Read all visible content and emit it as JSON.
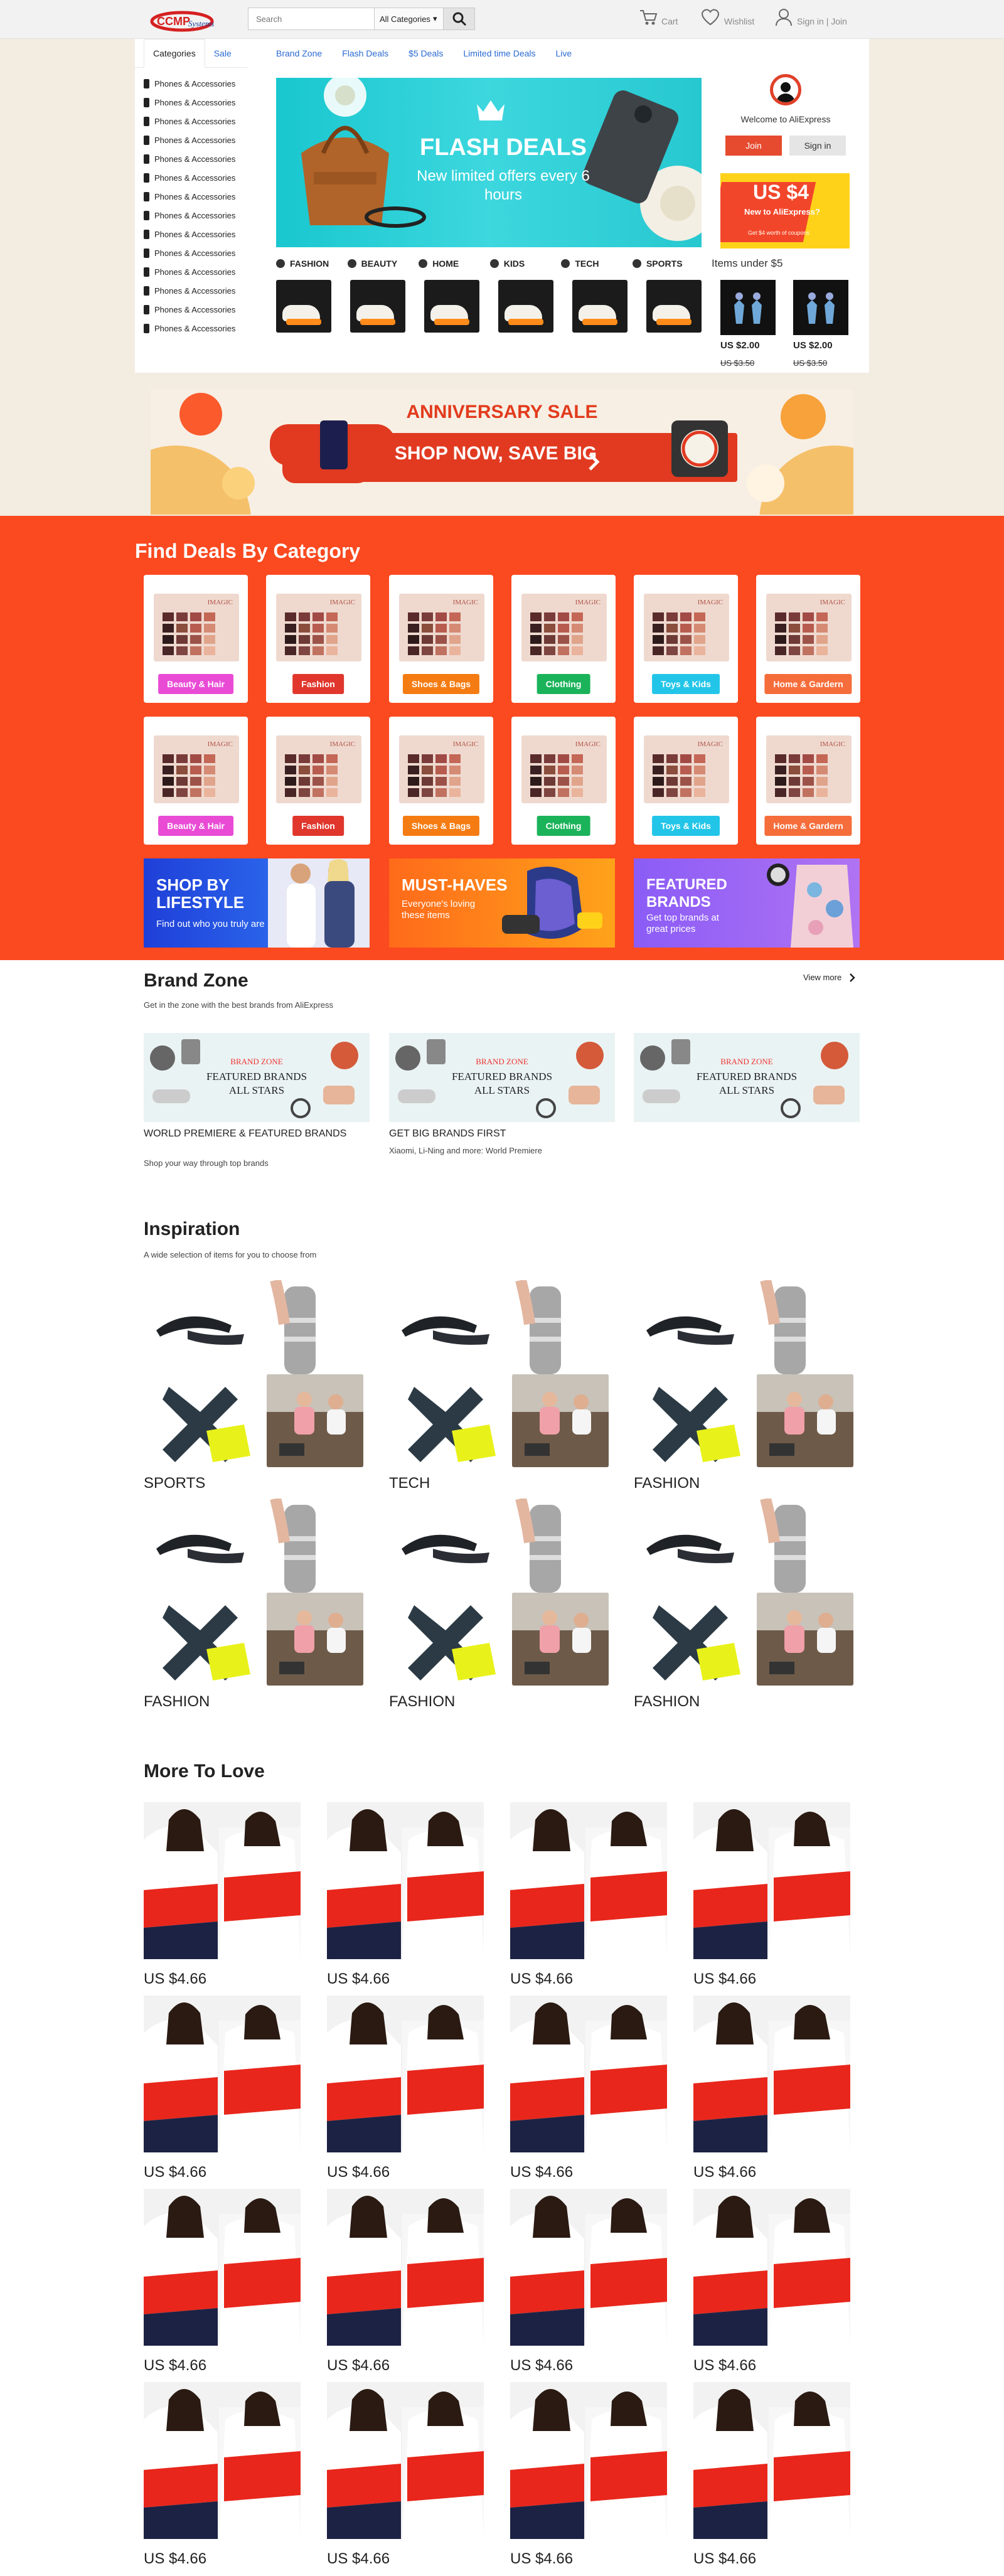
{
  "header": {
    "logo_text": "CCMPSystems",
    "search_placeholder": "Search",
    "category_select": "All Categories",
    "cart": "Cart",
    "wishlist": "Wishlist",
    "account": "Sign in | Join"
  },
  "sidebar": {
    "tabs": [
      "Categories",
      "Sale"
    ],
    "items": [
      "Phones & Accessories",
      "Phones & Accessories",
      "Phones & Accessories",
      "Phones & Accessories",
      "Phones & Accessories",
      "Phones & Accessories",
      "Phones & Accessories",
      "Phones & Accessories",
      "Phones & Accessories",
      "Phones & Accessories",
      "Phones & Accessories",
      "Phones & Accessories",
      "Phones & Accessories",
      "Phones & Accessories"
    ]
  },
  "subnav": [
    "Brand Zone",
    "Flash Deals",
    "$5 Deals",
    "Limited time Deals",
    "Live"
  ],
  "hero": {
    "title": "FLASH DEALS",
    "subtitle": "New limited offers every 6 hours"
  },
  "category_tabs": [
    "FASHION",
    "BEAUTY",
    "HOME",
    "KIDS",
    "TECH",
    "SPORTS"
  ],
  "user_panel": {
    "welcome": "Welcome to AliExpress",
    "join": "Join",
    "sign_in": "Sign in"
  },
  "promo": {
    "price": "US $4",
    "line1": "New to AliExpress?",
    "line2": "Get $4 worth of coupons"
  },
  "items_under": {
    "title": "Items under $5",
    "items": [
      {
        "price": "US $2.00",
        "old_price": "US $3.50"
      },
      {
        "price": "US $2.00",
        "old_price": "US $3.50"
      }
    ]
  },
  "anniversary": {
    "title": "ANNIVERSARY SALE",
    "cta": "SHOP NOW, SAVE BIG"
  },
  "find_deals": {
    "title": "Find Deals By Category",
    "palette_brand": "IMAGIC",
    "row1": [
      {
        "label": "Beauty & Hair",
        "color": "#e94bd5"
      },
      {
        "label": "Fashion",
        "color": "#e0362c"
      },
      {
        "label": "Shoes & Bags",
        "color": "#f57c12"
      },
      {
        "label": "Clothing",
        "color": "#1bb35a"
      },
      {
        "label": "Toys & Kids",
        "color": "#22c5e8"
      },
      {
        "label": "Home & Gardern",
        "color": "#f56d3b"
      }
    ],
    "row2": [
      {
        "label": "Beauty & Hair",
        "color": "#e94bd5"
      },
      {
        "label": "Fashion",
        "color": "#e0362c"
      },
      {
        "label": "Shoes & Bags",
        "color": "#f57c12"
      },
      {
        "label": "Clothing",
        "color": "#1bb35a"
      },
      {
        "label": "Toys & Kids",
        "color": "#22c5e8"
      },
      {
        "label": "Home & Gardern",
        "color": "#f56d3b"
      }
    ],
    "banners": [
      {
        "title": "SHOP BY LIFESTYLE",
        "sub": "Find out who you truly are"
      },
      {
        "title": "MUST-HAVES",
        "sub": "Everyone's loving these items"
      },
      {
        "title": "FEATURED BRANDS",
        "sub": "Get top brands at great prices"
      }
    ]
  },
  "brand_zone": {
    "title": "Brand Zone",
    "subtitle": "Get in the zone with the best brands from AliExpress",
    "view_more": "View more",
    "card_line1": "BRAND ZONE",
    "card_line2": "FEATURED BRANDS",
    "card_line3": "ALL STARS",
    "cards": [
      {
        "title": "WORLD PREMIERE & FEATURED BRANDS",
        "sub": "Shop your way through top brands"
      },
      {
        "title": "GET BIG BRANDS FIRST",
        "sub": "Xiaomi, Li-Ning and more: World Premiere"
      }
    ]
  },
  "inspiration": {
    "title": "Inspiration",
    "subtitle": "A wide selection of items for you to choose from",
    "tiles": [
      "SPORTS",
      "TECH",
      "FASHION",
      "FASHION",
      "FASHION",
      "FASHION"
    ]
  },
  "more_to_love": {
    "title": "More To Love",
    "price": "US $4.66"
  }
}
